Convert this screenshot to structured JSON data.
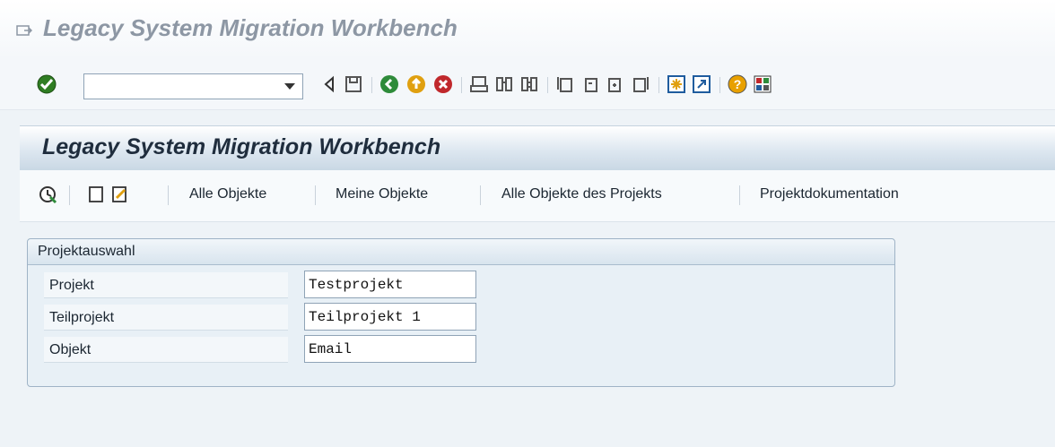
{
  "window": {
    "title": "Legacy System Migration Workbench"
  },
  "toolbar": {
    "command_field": {
      "value": "",
      "placeholder": ""
    },
    "icons": [
      "enter-icon",
      "back-icon",
      "save-icon",
      "back-green-icon",
      "exit-icon",
      "cancel-icon",
      "print-icon",
      "find-icon",
      "find-next-icon",
      "first-page-icon",
      "previous-page-icon",
      "next-page-icon",
      "last-page-icon",
      "create-session-icon",
      "shortcut-icon",
      "help-icon",
      "customize-layout-icon"
    ],
    "colors": {
      "enter": "#3a8a2a",
      "back": "#2e8b3a",
      "exit": "#e0a010",
      "cancel": "#c0282c",
      "help": "#e8a000"
    }
  },
  "app": {
    "title": "Legacy System Migration Workbench",
    "toolbar": {
      "items": [
        "Alle Objekte",
        "Meine Objekte",
        "Alle Objekte des Projekts",
        "Projektdokumentation"
      ],
      "icons": [
        "execute-icon",
        "create-icon",
        "change-icon"
      ]
    }
  },
  "group": {
    "label": "Projektauswahl",
    "rows": [
      {
        "label": "Projekt",
        "value": "Testprojekt"
      },
      {
        "label": "Teilprojekt",
        "value": "Teilprojekt 1"
      },
      {
        "label": "Objekt",
        "value": "Email"
      }
    ]
  }
}
